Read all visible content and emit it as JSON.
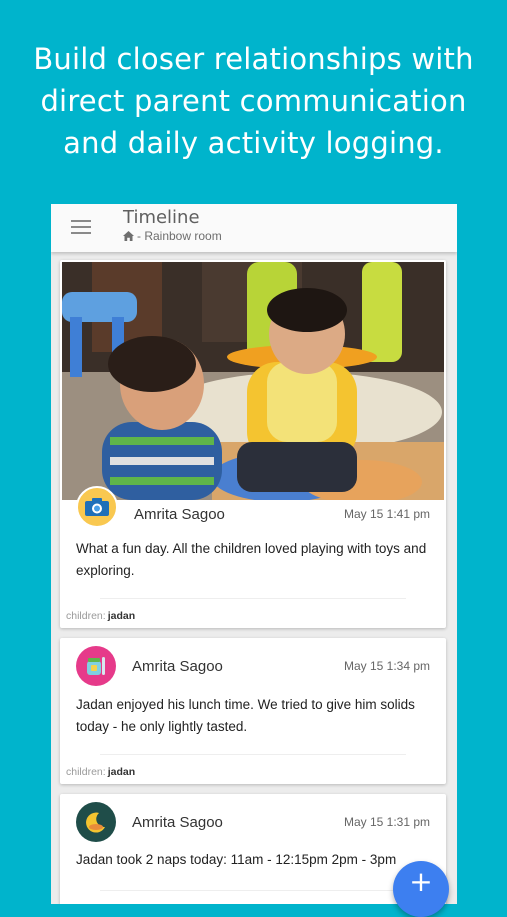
{
  "headline": {
    "line1": "Build closer relationships with",
    "line2": "direct parent communication",
    "line3": "and daily activity logging."
  },
  "appbar": {
    "title": "Timeline",
    "subtitle": "- Rainbow room",
    "menu_icon": "hamburger-menu-icon",
    "room_icon": "home-icon"
  },
  "posts": [
    {
      "author": "Amrita Sagoo",
      "time": "May 15 1:41 pm",
      "text": "What a fun day. All the children loved playing with toys and exploring.",
      "children_label": "children:",
      "children_value": "jadan",
      "avatar_icon": "camera-icon",
      "avatar_color": "#f9c850",
      "has_photo": true
    },
    {
      "author": "Amrita Sagoo",
      "time": "May 15 1:34 pm",
      "text": "Jadan enjoyed his lunch time. We tried to give him solids today - he only lightly tasted.",
      "children_label": "children:",
      "children_value": "jadan",
      "avatar_icon": "baby-food-icon",
      "avatar_color": "#e63a8a"
    },
    {
      "author": "Amrita Sagoo",
      "time": "May 15 1:31 pm",
      "text": "Jadan took 2 naps today: 11am - 12:15pm 2pm - 3pm",
      "avatar_icon": "moon-icon",
      "avatar_color": "#1f4d49"
    }
  ],
  "fab": {
    "label": "+",
    "icon": "plus-icon"
  },
  "colors": {
    "background": "#00b4cc",
    "fab": "#3d7ff0",
    "appbar": "#fafafa"
  }
}
